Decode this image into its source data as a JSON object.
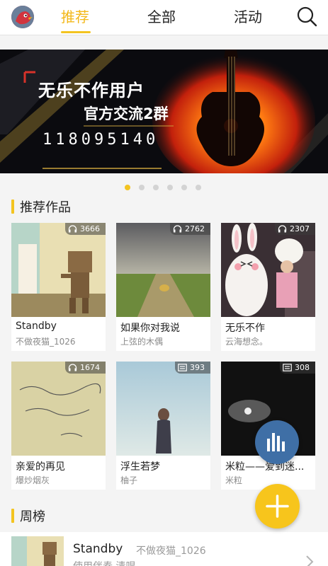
{
  "nav": {
    "tabs": [
      {
        "label": "推荐",
        "active": true
      },
      {
        "label": "全部",
        "active": false
      },
      {
        "label": "活动",
        "active": false
      }
    ],
    "accent": "#f3b81a"
  },
  "banner": {
    "line1": "无乐不作用户",
    "line2": "官方交流2群",
    "number": "118095140"
  },
  "carousel": {
    "count": 6,
    "active_index": 0
  },
  "recommended": {
    "title": "推荐作品",
    "items": [
      {
        "title": "Standby",
        "author": "不做夜猫_1026",
        "count": "3666",
        "icon": "headphones-icon"
      },
      {
        "title": "如果你对我说",
        "author": "上弦的木偶",
        "count": "2762",
        "icon": "headphones-icon"
      },
      {
        "title": "无乐不作",
        "author": "云海想念。",
        "count": "2307",
        "icon": "headphones-icon"
      },
      {
        "title": "亲爱的再见",
        "author": "爆炒烟灰",
        "count": "1674",
        "icon": "headphones-icon"
      },
      {
        "title": "浮生若梦",
        "author": "柚子",
        "count": "393",
        "icon": "article-icon"
      },
      {
        "title": "米粒——爱到迷...",
        "author": "米粒",
        "count": "308",
        "icon": "article-icon"
      }
    ]
  },
  "weekly": {
    "title": "周榜",
    "item": {
      "title": "Standby",
      "author": "不做夜猫_1026",
      "subtitle": "使用伴奏 清唱"
    }
  }
}
